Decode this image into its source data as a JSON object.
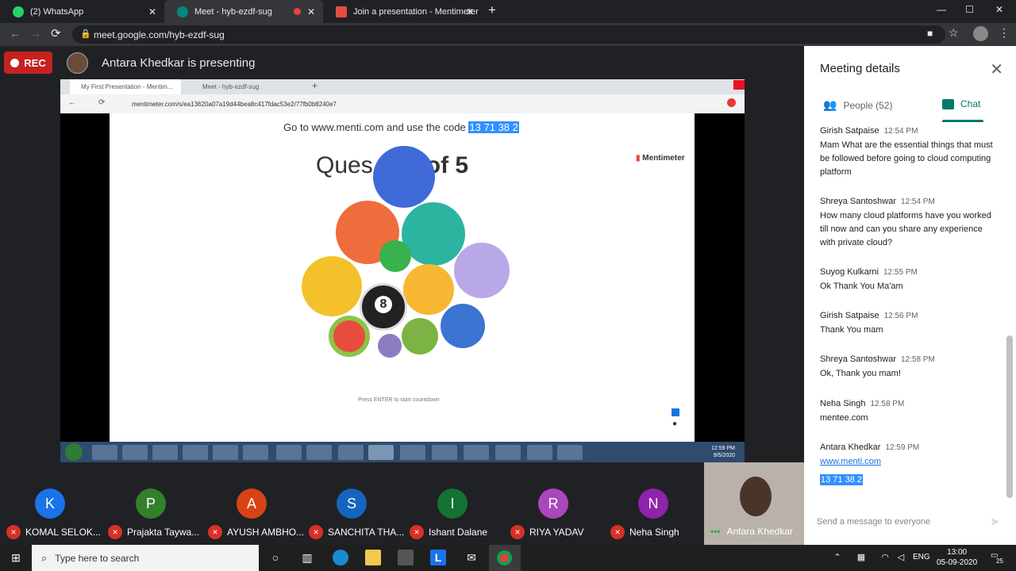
{
  "browser": {
    "tabs": [
      {
        "label": "(2) WhatsApp",
        "color": "#25d366"
      },
      {
        "label": "Meet - hyb-ezdf-sug",
        "color": "#00897b"
      },
      {
        "label": "Join a presentation - Mentimeter",
        "color": "#e64a45"
      }
    ],
    "url": "meet.google.com/hyb-ezdf-sug"
  },
  "meet": {
    "rec_label": "REC",
    "presenting_text": "Antara Khedkar is presenting"
  },
  "shared_screen": {
    "inner_tabs": [
      "My First Presentation - Mentim...",
      "Meet - hyb-ezdf-sug"
    ],
    "inner_url": "mentimeter.com/s/ea13620a07a19d44bea8c417fdac53e2/77fb0b8240e7",
    "goto_text": "Go to www.menti.com and use the code",
    "code": "13 71 38 2",
    "logo": "Mentimeter",
    "question_prefix": "Ques",
    "question_suffix": "1 of 5",
    "enter_text": "Press ENTER to start countdown",
    "win7_time": "12:59 PM",
    "win7_date": "9/5/2020"
  },
  "participants": [
    {
      "initial": "K",
      "name": "KOMAL SELOK...",
      "color": "#1a73e8"
    },
    {
      "initial": "P",
      "name": "Prajakta Taywa...",
      "color": "#33802b"
    },
    {
      "initial": "A",
      "name": "AYUSH AMBHO...",
      "color": "#d84315"
    },
    {
      "initial": "S",
      "name": "SANCHITA THA...",
      "color": "#1565c0"
    },
    {
      "initial": "I",
      "name": "Ishant Dalane",
      "color": "#137333"
    },
    {
      "initial": "R",
      "name": "RIYA YADAV",
      "color": "#ab47bc"
    },
    {
      "initial": "N",
      "name": "Neha Singh",
      "color": "#8e24aa"
    }
  ],
  "self": {
    "name": "Antara Khedkar"
  },
  "panel": {
    "title": "Meeting details",
    "people_tab": "People (52)",
    "chat_tab": "Chat",
    "messages": [
      {
        "sender": "Girish Satpaise",
        "time": "12:54 PM",
        "text": "Mam What are the essential things that must be followed before going to cloud computing platform"
      },
      {
        "sender": "Shreya Santoshwar",
        "time": "12:54 PM",
        "text": "How many cloud platforms have you worked till now and can you share any experience with private cloud?"
      },
      {
        "sender": "Suyog Kulkarni",
        "time": "12:55 PM",
        "text": "Ok Thank You Ma'am"
      },
      {
        "sender": "Girish Satpaise",
        "time": "12:56 PM",
        "text": "Thank You mam"
      },
      {
        "sender": "Shreya Santoshwar",
        "time": "12:58 PM",
        "text": "Ok, Thank you mam!"
      },
      {
        "sender": "Neha Singh",
        "time": "12:58 PM",
        "text": "mentee.com"
      },
      {
        "sender": "Antara Khedkar",
        "time": "12:59 PM",
        "link": "www.menti.com",
        "highlight": "13 71 38 2"
      }
    ],
    "input_placeholder": "Send a message to everyone"
  },
  "taskbar": {
    "search_placeholder": "Type here to search",
    "lang": "ENG",
    "time": "13:00",
    "date": "05-09-2020",
    "notif_count": "25"
  }
}
